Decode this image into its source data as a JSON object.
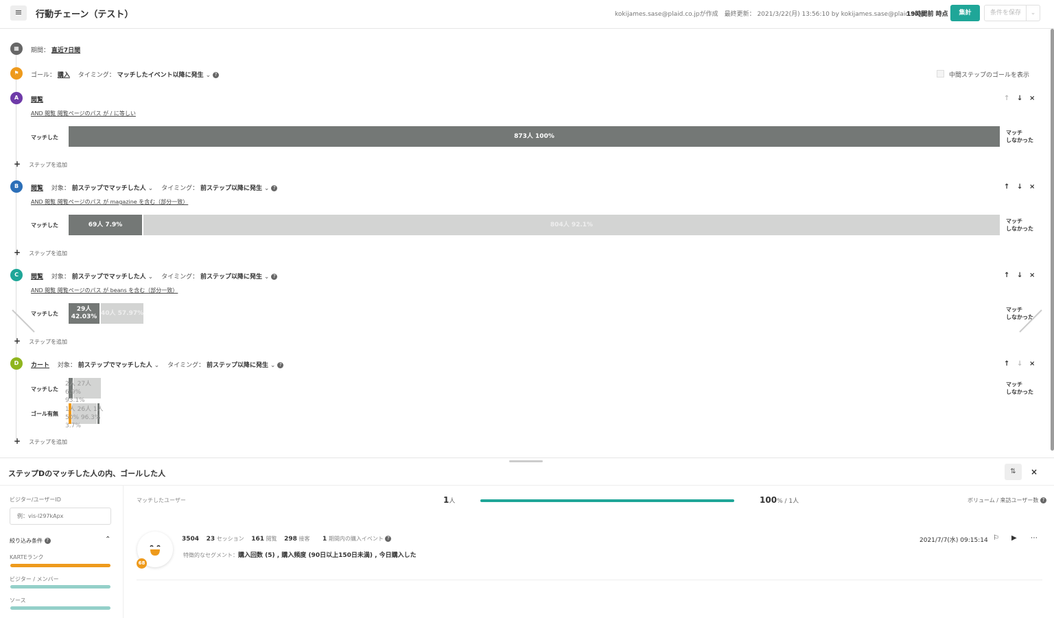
{
  "header": {
    "title": "行動チェーン（テスト）",
    "meta": "kokijames.sase@plaid.co.jpが作成　最終更新： 2021/3/22(月) 13:56:10 by kokijames.sase@plaid.co.jp",
    "as_of": "19時間前 時点",
    "run_label": "集計",
    "save_label": "条件を保存"
  },
  "period": {
    "label": "期間：",
    "value": "直近7日間"
  },
  "goal": {
    "label": "ゴール：",
    "value": "購入",
    "timing_label": "タイミング：",
    "timing_value": "マッチしたイベント以降に発生",
    "show_mid_goal_label": "中間ステップのゴールを表示"
  },
  "labels": {
    "matched": "マッチした",
    "not_matched_1": "マッチ",
    "not_matched_2": "しなかった",
    "add_step": "ステップを追加",
    "goal_row": "ゴール有無",
    "target_label": "対象：",
    "target_value": "前ステップでマッチした人",
    "timing_label": "タイミング：",
    "timing_value": "前ステップ以降に発生"
  },
  "steps": [
    {
      "letter": "A",
      "event": "閲覧",
      "condition": "AND 閲覧 閲覧ページのパス が / に等しい",
      "matched_text": "873人 100%",
      "matched_fraction": 1.0,
      "color": "#6e3aa8"
    },
    {
      "letter": "B",
      "event": "閲覧",
      "condition": "AND 閲覧 閲覧ページのパス が magazine を含む（部分一致）",
      "matched_text": "69人 7.9%",
      "unmatched_text": "804人 92.1%",
      "matched_fraction": 0.079,
      "color": "#2c6fb8"
    },
    {
      "letter": "C",
      "event": "閲覧",
      "condition": "AND 閲覧 閲覧ページのパス が beans を含む（部分一致）",
      "matched_line1": "29人",
      "matched_line2": "42.03%",
      "unmatched_text": "40人 57.97%",
      "color": "#1fa698"
    },
    {
      "letter": "D",
      "event": "カート",
      "matched_text": "2人 27人 6.9% 93.1%",
      "goal_text": "1人 26人 1人 50% 96.3% 3.7%",
      "color": "#8fb51e"
    }
  ],
  "panel": {
    "title": "ステップDのマッチした人の内、ゴールした人",
    "visitor_id_label": "ビジター/ユーザーID",
    "visitor_id_placeholder": "例：vis-l297kApx",
    "filter_label": "絞り込み条件",
    "filters": [
      "KARTEランク",
      "ビジター / メンバー",
      "ソース"
    ],
    "matched_users_label": "マッチしたユーザー",
    "count": "1",
    "count_unit": "人",
    "progress": 1.0,
    "percent": "100",
    "percent_unit": "% / 1人",
    "volume_label": "ボリューム / 来訪ユーザー数",
    "user": {
      "rank": "68",
      "sessions": "3504",
      "sessions_label": "セッション",
      "s2": "23",
      "s2_label": "セッション",
      "views": "161",
      "views_label": "閲覧",
      "contacts": "298",
      "contacts_label": "接客",
      "purchase": "1",
      "purchase_label": "期間内の購入イベント",
      "segment_label": "特徴的なセグメント：",
      "segments": "購入回数 (5) , 購入頻度 (90日以上150日未満) , 今日購入した",
      "date": "2021/7/7(水) 09:15:14"
    }
  },
  "colors": {
    "accent": "#1fa698",
    "goal": "#ee9a1c",
    "period": "#666666"
  }
}
